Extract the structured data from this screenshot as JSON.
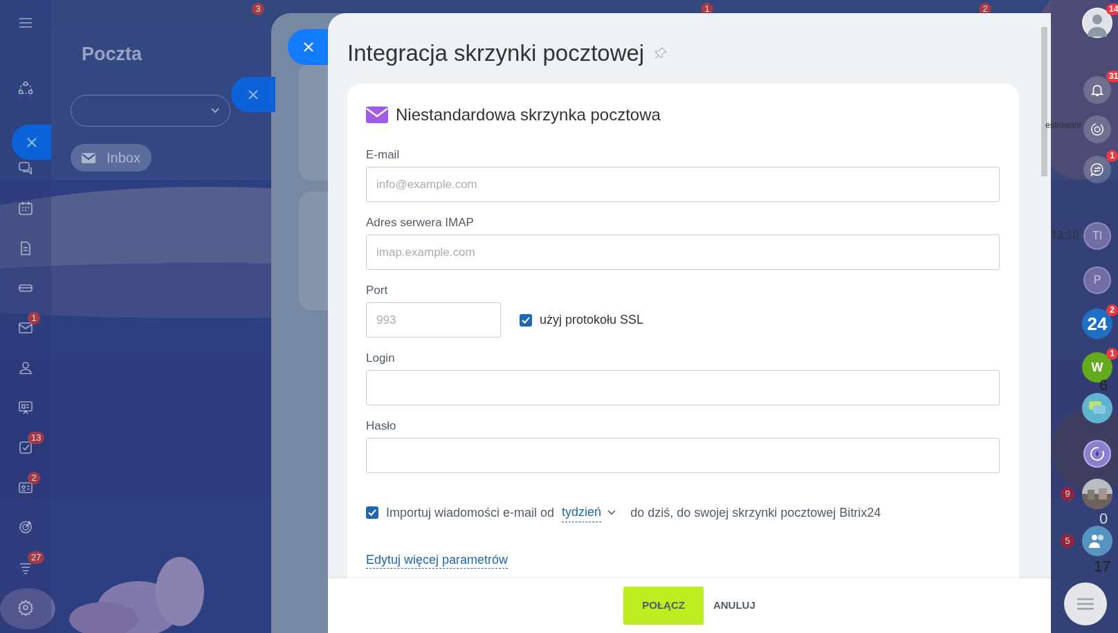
{
  "left_nav": [
    {
      "kind": "menu"
    },
    {
      "kind": "nodes"
    },
    {
      "kind": "chat"
    },
    {
      "kind": "calendar"
    },
    {
      "kind": "document"
    },
    {
      "kind": "drive"
    },
    {
      "kind": "mail",
      "badge": "1"
    },
    {
      "kind": "people"
    },
    {
      "kind": "board"
    },
    {
      "kind": "task",
      "badge": "13"
    },
    {
      "kind": "card",
      "badge": "2"
    },
    {
      "kind": "target"
    },
    {
      "kind": "stream",
      "badge": "27"
    },
    {
      "kind": "gear"
    }
  ],
  "top_badges": [
    "3",
    "1",
    "2"
  ],
  "mail_panel": {
    "title": "Poczta",
    "folder": "Inbox"
  },
  "modal": {
    "title": "Integracja skrzynki pocztowej",
    "section": "Niestandardowa skrzynka pocztowa",
    "fields": [
      {
        "label": "E-mail",
        "placeholder": "info@example.com"
      },
      {
        "label": "Adres serwera IMAP",
        "placeholder": "imap.example.com"
      },
      {
        "label": "Port",
        "placeholder": "993",
        "kind": "port",
        "option": {
          "label": "użyj protokołu SSL",
          "checked": true
        }
      },
      {
        "label": "Login"
      },
      {
        "label": "Hasło"
      }
    ],
    "import": {
      "checked": true,
      "before": "Importuj wiadomości e-mail od",
      "period": "tydzień",
      "after": "do dziś, do swojej skrzynki pocztowej Bitrix24"
    },
    "more_link": "Edytuj więcej parametrów",
    "buttons": [
      {
        "label": "POŁĄCZ",
        "kind": "primary"
      },
      {
        "label": "ANULUJ",
        "kind": "link"
      }
    ]
  },
  "right_rail": [
    {
      "kind": "avatar",
      "badge": "14"
    },
    {
      "kind": "bell",
      "badge": "31"
    },
    {
      "kind": "sync"
    },
    {
      "kind": "chat-swap",
      "badge": "1"
    },
    {
      "kind": "initials",
      "text": "TI"
    },
    {
      "kind": "initials",
      "text": "P"
    },
    {
      "kind": "brand-blue",
      "text": "24",
      "badge": "2"
    },
    {
      "kind": "brand-green",
      "text": "W",
      "badge": "1"
    },
    {
      "kind": "bubbles"
    },
    {
      "kind": "compass"
    },
    {
      "side_badge": "9"
    },
    {
      "kind": "group",
      "side_badge": "5"
    }
  ],
  "rail_fragments": [
    "estrowani",
    "13:10",
    "6",
    "0",
    "17"
  ]
}
